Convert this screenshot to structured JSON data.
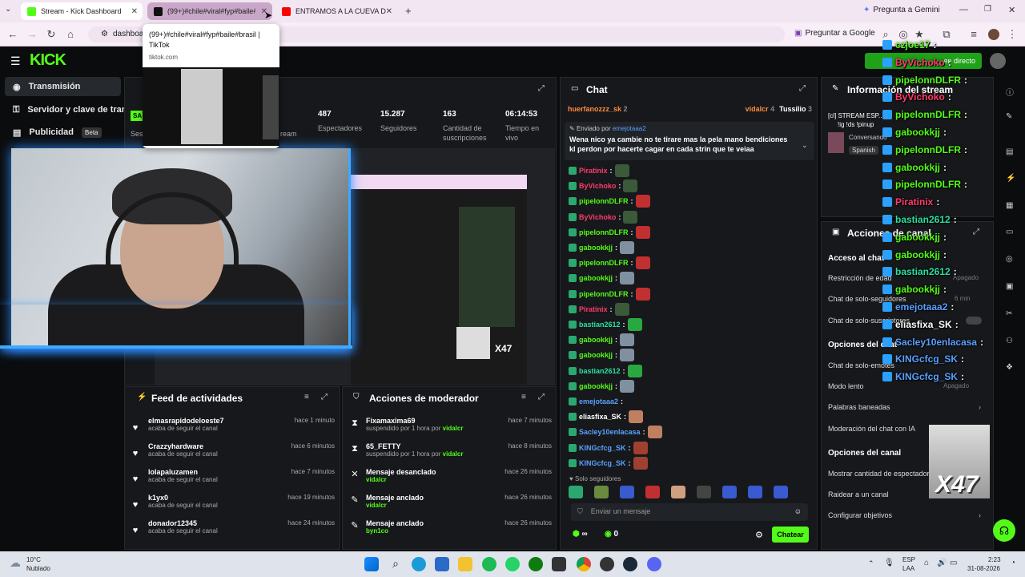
{
  "browser": {
    "tabs": [
      {
        "label": "Stream - Kick Dashboard",
        "fav_color": "#53fc18"
      },
      {
        "label": "(99+)#chile#viral#fyp#baile#br",
        "fav_color": "#111111"
      },
      {
        "label": "ENTRAMOS A LA CUEVA DE LA",
        "fav_color": "#ff0000"
      }
    ],
    "gemini_label": "Pregunta a Gemini",
    "url": "dashboard.k",
    "translate_label": "Preguntar a Google",
    "tooltip": {
      "title": "(99+)#chile#viral#fyp#baile#brasil | TikTok",
      "domain": "tiktok.com"
    }
  },
  "kick": {
    "logo": "KICK",
    "live_label": "en directo",
    "sidebar": [
      {
        "label": "Transmisión",
        "icon": "broadcast-icon"
      },
      {
        "label": "Servidor y clave de transm",
        "icon": "key-icon"
      },
      {
        "label": "Publicidad",
        "badge": "Beta",
        "icon": "ad-icon"
      }
    ],
    "stats": [
      {
        "value": "487",
        "label": "Espectadores"
      },
      {
        "value": "15.287",
        "label": "Seguidores"
      },
      {
        "value": "163",
        "label": "Cantidad de suscripciones"
      },
      {
        "value": "06:14:53",
        "label": "Tiempo en vivo"
      }
    ],
    "stat_partial": {
      "sess": "Ses",
      "ream": "ream",
      "sa": "SA"
    },
    "activity": {
      "title": "Feed de actividades",
      "items": [
        {
          "name": "elmasrapidodeloeste7",
          "sub": "acaba de seguir el canal",
          "time": "hace 1 minuto"
        },
        {
          "name": "Crazzyhardware",
          "sub": "acaba de seguir el canal",
          "time": "hace 6 minutos"
        },
        {
          "name": "lolapaluzamen",
          "sub": "acaba de seguir el canal",
          "time": "hace 7 minutos"
        },
        {
          "name": "k1yx0",
          "sub": "acaba de seguir el canal",
          "time": "hace 19 minutos"
        },
        {
          "name": "donador12345",
          "sub": "acaba de seguir el canal",
          "time": "hace 24 minutos"
        }
      ]
    },
    "modactions": {
      "title": "Acciones de moderador",
      "items": [
        {
          "name": "Fixamaxima69",
          "sub": "suspendido por 1 hora por",
          "by": "vidalcr",
          "time": "hace 7 minutos",
          "icon": "hourglass-icon"
        },
        {
          "name": "65_FETTY",
          "sub": "suspendido por 1 hora por",
          "by": "vidalcr",
          "time": "hace 8 minutos",
          "icon": "hourglass-icon"
        },
        {
          "name": "Mensaje desanclado",
          "sub": "por",
          "by": "vidalcr",
          "time": "hace 26 minutos",
          "icon": "unpin-icon"
        },
        {
          "name": "Mensaje anclado",
          "sub": "por",
          "by": "vidalcr",
          "time": "hace 26 minutos",
          "icon": "pin-icon"
        },
        {
          "name": "Mensaje anclado",
          "sub": "por",
          "by": "byn1co",
          "time": "hace 26 minutos",
          "icon": "pin-icon"
        }
      ]
    },
    "chat": {
      "title": "Chat",
      "top_users": [
        {
          "name": "huerfanozzz_sk",
          "count": "2",
          "color": "#ff8a3d"
        },
        {
          "name": "vidalcr",
          "count": "4",
          "color": "#ff8a3d"
        },
        {
          "name": "Tussilio",
          "count": "3",
          "color": "#ffffff"
        }
      ],
      "pinned_by_label": "Enviado por",
      "pinned_by": "emejotaaa2",
      "pinned_text": "Wena nico ya cambie no te tirare mas la pela mano bendiciones kl perdon por hacerte cagar en cada strin que te veiaa",
      "messages": [
        {
          "user": "Piratinix",
          "color": "#ff3b6b"
        },
        {
          "user": "ByVichoko",
          "color": "#ff3b6b"
        },
        {
          "user": "pipelonnDLFR",
          "color": "#53fc18"
        },
        {
          "user": "ByVichoko",
          "color": "#ff3b6b"
        },
        {
          "user": "pipelonnDLFR",
          "color": "#53fc18"
        },
        {
          "user": "gabookkjj",
          "color": "#53fc18"
        },
        {
          "user": "pipelonnDLFR",
          "color": "#53fc18"
        },
        {
          "user": "gabookkjj",
          "color": "#53fc18"
        },
        {
          "user": "pipelonnDLFR",
          "color": "#53fc18"
        },
        {
          "user": "Piratinix",
          "color": "#ff3b6b"
        },
        {
          "user": "bastian2612",
          "color": "#2be0a0"
        },
        {
          "user": "gabookkjj",
          "color": "#53fc18"
        },
        {
          "user": "gabookkjj",
          "color": "#53fc18"
        },
        {
          "user": "bastian2612",
          "color": "#2be0a0"
        },
        {
          "user": "gabookkjj",
          "color": "#53fc18"
        },
        {
          "user": "emejotaaa2",
          "color": "#5aa0ff"
        },
        {
          "user": "eliasfixa_SK",
          "color": "#ffffff"
        },
        {
          "user": "Sacley10enlacasa",
          "color": "#5aa0ff"
        },
        {
          "user": "KINGcfcg_SK",
          "color": "#5aa0ff"
        },
        {
          "user": "KINGcfcg_SK",
          "color": "#5aa0ff"
        }
      ],
      "followers_only": "Solo seguidores",
      "input_placeholder": "Enviar un mensaje",
      "infinity": "∞",
      "points": "0",
      "send_label": "Chatear"
    },
    "info": {
      "title": "Información del stream",
      "stream_title": "[cl] STREAM ESP...",
      "stream_sub": "!ig !ds !pinup",
      "category": "Conversando",
      "language": "Spanish"
    },
    "channel_actions": {
      "title": "Acciones de canal",
      "chat_access": "Acceso al chat",
      "rows": [
        {
          "label": "Restricción de edad",
          "value": "Apagado"
        },
        {
          "label": "Chat de solo-seguidores",
          "value": "6 min"
        },
        {
          "label": "Chat de solo-suscriptores",
          "value": ""
        }
      ],
      "chat_options": "Opciones del chat",
      "rows2": [
        {
          "label": "Chat de solo-emotes",
          "value": ""
        },
        {
          "label": "Modo lento",
          "value": "Apagado"
        },
        {
          "label": "Palabras baneadas",
          "value": ""
        },
        {
          "label": "Moderación del chat con IA",
          "value": ""
        }
      ],
      "channel_options": "Opciones del canal",
      "rows3": [
        {
          "label": "Mostrar cantidad de espectadores"
        },
        {
          "label": "Raidear a un canal"
        },
        {
          "label": "Configurar objetivos"
        }
      ]
    },
    "overlay_chat": [
      {
        "user": "czjoe17",
        "color": "#53fc18"
      },
      {
        "user": "ByVichoko",
        "color": "#ff3b6b"
      },
      {
        "user": "pipelonnDLFR",
        "color": "#53fc18"
      },
      {
        "user": "ByVichoko",
        "color": "#ff3b6b"
      },
      {
        "user": "pipelonnDLFR",
        "color": "#53fc18"
      },
      {
        "user": "gabookkjj",
        "color": "#53fc18"
      },
      {
        "user": "pipelonnDLFR",
        "color": "#53fc18"
      },
      {
        "user": "gabookkjj",
        "color": "#53fc18"
      },
      {
        "user": "pipelonnDLFR",
        "color": "#53fc18"
      },
      {
        "user": "Piratinix",
        "color": "#ff3b6b"
      },
      {
        "user": "bastian2612",
        "color": "#2be0a0"
      },
      {
        "user": "gabookkjj",
        "color": "#53fc18"
      },
      {
        "user": "gabookkjj",
        "color": "#53fc18"
      },
      {
        "user": "bastian2612",
        "color": "#2be0a0"
      },
      {
        "user": "gabookkjj",
        "color": "#53fc18"
      },
      {
        "user": "emejotaaa2",
        "color": "#5aa0ff"
      },
      {
        "user": "eliasfixa_SK",
        "color": "#ffffff"
      },
      {
        "user": "Sacley10enlacasa",
        "color": "#5aa0ff"
      },
      {
        "user": "KINGcfcg_SK",
        "color": "#5aa0ff"
      },
      {
        "user": "KINGcfcg_SK",
        "color": "#5aa0ff"
      }
    ],
    "overlay_badge": "X47",
    "screen_badge": "X47"
  },
  "taskbar": {
    "weather_temp": "10°C",
    "weather_desc": "Nublado",
    "lang": "ESP",
    "lang2": "LAA",
    "time": "2:23",
    "date": "31-08-2026"
  }
}
